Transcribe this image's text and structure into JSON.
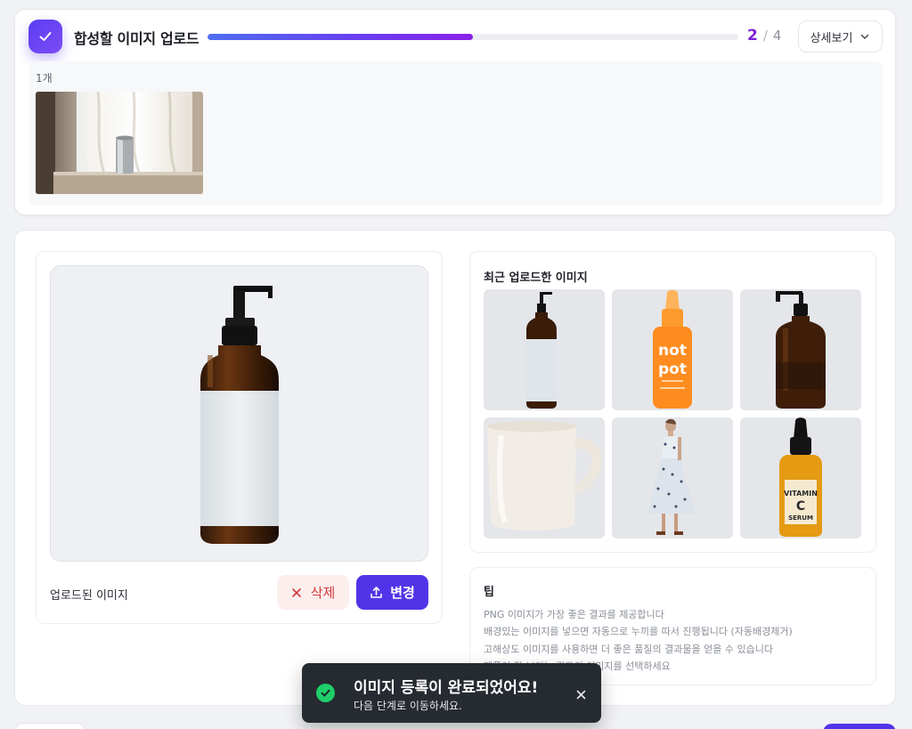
{
  "header": {
    "title": "합성할 이미지 업로드",
    "progress": 0.5,
    "step_current": "2",
    "step_separator": "/",
    "step_total": "4",
    "detail_label": "상세보기"
  },
  "upload_strip": {
    "count_label": "1개",
    "images": [
      {
        "icon": "window-can-photo"
      }
    ]
  },
  "preview": {
    "label": "업로드된 이미지",
    "image_icon": "amber-pump-bottle",
    "delete_label": "삭제",
    "change_label": "변경"
  },
  "recent": {
    "title": "최근 업로드한 이미지",
    "items": [
      {
        "icon": "amber-pump-bottle-white-label"
      },
      {
        "icon": "orange-dropper-bottle-not-pot"
      },
      {
        "icon": "amber-pump-bottle"
      },
      {
        "icon": "white-mug"
      },
      {
        "icon": "woman-floral-dress"
      },
      {
        "icon": "amber-dropper-bottle-vitamin-c"
      }
    ],
    "product_texts": {
      "not_pot_top": "not",
      "not_pot_bottom": "pot",
      "vitamin": "VITAMIN",
      "c": "C",
      "serum": "SERUM"
    }
  },
  "tips": {
    "title": "팁",
    "lines": [
      "PNG 이미지가 가장 좋은 결과를 제공합니다",
      "배경있는 이미지를 넣으면 자동으로 누끼를 따서 진행됩니다 (자동배경제거)",
      "고해상도 이미지를 사용하면 더 좋은 품질의 결과물을 얻을 수 있습니다",
      "제품이 잘 보이는 각도의 이미지를 선택하세요"
    ]
  },
  "toast": {
    "title": "이미지 등록이 완료되었어요!",
    "subtitle": "다음 단계로 이동하세요."
  },
  "colors": {
    "accent": "#5234e8",
    "progress_end": "#8b22e8",
    "delete": "#d23a3a",
    "success": "#1fcf6a"
  }
}
